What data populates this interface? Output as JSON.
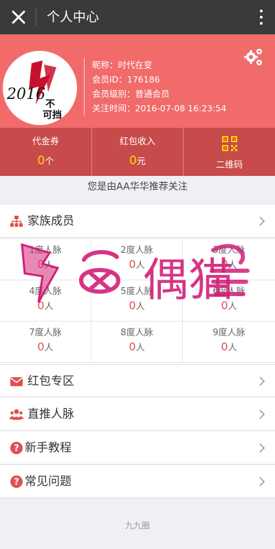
{
  "topbar": {
    "title": "个人中心",
    "close_icon": "close-icon",
    "more_icon": "more-vertical-icon"
  },
  "profile": {
    "avatar_text_1": "2016",
    "avatar_text_2": "势不可挡",
    "nickname": "昵称：时代在变",
    "member_id": "会员ID：176186",
    "level": "会员级别：普通会员",
    "follow_time": "关注时间：2016-07-08 16:23:54",
    "settings_icon": "gears-icon"
  },
  "stats": {
    "voucher": {
      "label": "代金券",
      "value": "0",
      "unit": "个"
    },
    "redpack": {
      "label": "红包收入",
      "value": "0",
      "unit": "元"
    },
    "qrcode": {
      "label": "二维码",
      "icon": "qrcode-icon"
    }
  },
  "referral": "您是由AA华华推荐关注",
  "family": {
    "label": "家族成员",
    "icon": "sitemap-icon"
  },
  "network": [
    {
      "label": "1度人脉",
      "value": "0",
      "unit": "人"
    },
    {
      "label": "2度人脉",
      "value": "0",
      "unit": "人"
    },
    {
      "label": "3度人脉",
      "value": "0",
      "unit": "人"
    },
    {
      "label": "4度人脉",
      "value": "0",
      "unit": "人"
    },
    {
      "label": "5度人脉",
      "value": "0",
      "unit": "人"
    },
    {
      "label": "6度人脉",
      "value": "0",
      "unit": "人"
    },
    {
      "label": "7度人脉",
      "value": "0",
      "unit": "人"
    },
    {
      "label": "8度人脉",
      "value": "0",
      "unit": "人"
    },
    {
      "label": "9度人脉",
      "value": "0",
      "unit": "人"
    }
  ],
  "menu": [
    {
      "label": "红包专区",
      "icon": "envelope-icon"
    },
    {
      "label": "直推人脉",
      "icon": "users-icon"
    },
    {
      "label": "新手教程",
      "icon": "question-circle-icon"
    },
    {
      "label": "常见问题",
      "icon": "question-circle-icon"
    }
  ],
  "watermark": "偶猫",
  "footer": "九九圈",
  "colors": {
    "header": "#f16b6b",
    "stats": "#c84b4b",
    "accent": "#ffd400",
    "icon_red": "#e05050",
    "topbar": "#3a3a3a"
  }
}
